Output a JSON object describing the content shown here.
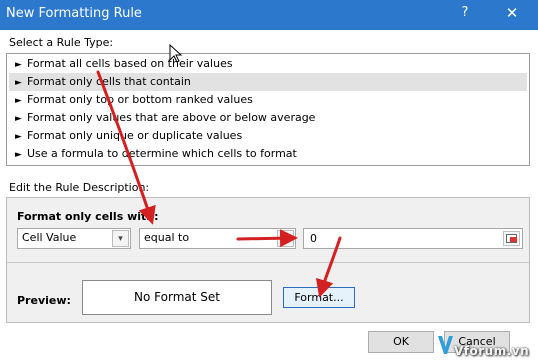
{
  "window": {
    "title": "New Formatting Rule",
    "help_label": "?",
    "close_label": "✕"
  },
  "rule_type": {
    "label": "Select a Rule Type:",
    "items": [
      {
        "label": "Format all cells based on their values",
        "selected": false
      },
      {
        "label": "Format only cells that contain",
        "selected": true
      },
      {
        "label": "Format only top or bottom ranked values",
        "selected": false
      },
      {
        "label": "Format only values that are above or below average",
        "selected": false
      },
      {
        "label": "Format only unique or duplicate values",
        "selected": false
      },
      {
        "label": "Use a formula to determine which cells to format",
        "selected": false
      }
    ]
  },
  "rule_description": {
    "label": "Edit the Rule Description:",
    "format_only_label": "Format only cells with:",
    "condition_type": {
      "value": "Cell Value"
    },
    "operator": {
      "value": "equal to"
    },
    "value_field": {
      "value": "0"
    },
    "preview_label": "Preview:",
    "preview_text": "No Format Set",
    "format_button": "Format..."
  },
  "buttons": {
    "ok": "OK",
    "cancel": "Cancel"
  },
  "watermark": {
    "text": "Vforum.vn"
  },
  "colors": {
    "titlebar": "#2b78cd",
    "annotation_arrow": "#d42020",
    "selected_row": "#e2e2e2"
  },
  "icons": {
    "list_bullet": "right-arrow-bullet",
    "dropdown": "chevron-down-icon",
    "range_selector": "collapse-dialog-icon"
  }
}
